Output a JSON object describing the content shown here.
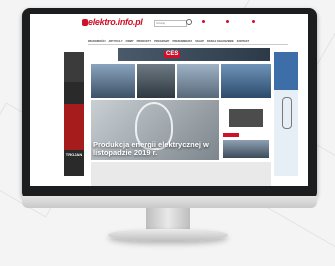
{
  "site": {
    "logo": "elektro.info.pl",
    "search_placeholder": "Szukaj",
    "header_links": [
      "",
      "",
      ""
    ]
  },
  "nav": {
    "items": [
      "WIADOMOŚCI",
      "ARTYKUŁY",
      "FIRMY",
      "PRODUKTY",
      "PROGRAMY",
      "PRENUMERATA",
      "SKLEP",
      "DODAJ OGŁOSZENIE",
      "KONTAKT"
    ]
  },
  "banner": {
    "label": "CES"
  },
  "tiles": [
    {
      "caption": ""
    },
    {
      "caption": ""
    },
    {
      "caption": ""
    },
    {
      "caption": "Produkcja energii elektrycznej w listopadzie 2019 r."
    },
    {
      "caption": ""
    }
  ],
  "side_ads": {
    "left_brand": "TROJAN"
  }
}
